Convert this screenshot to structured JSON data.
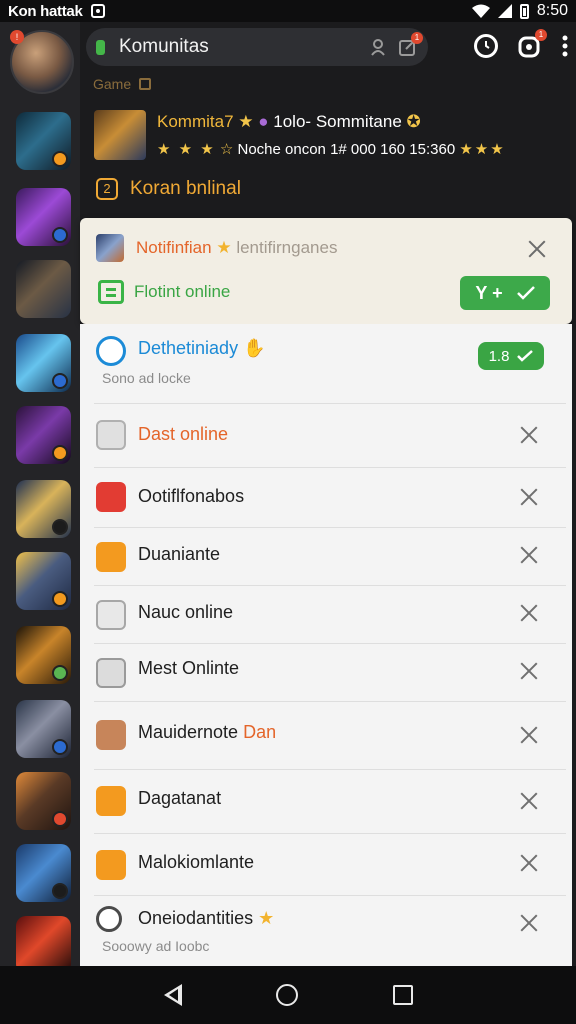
{
  "status_bar": {
    "title": "Kon hattak",
    "time": "8:50"
  },
  "top_bar": {
    "search_label": "Komunitas",
    "badge_count_1": "1",
    "badge_count_2": "1"
  },
  "section": {
    "label": "Game"
  },
  "featured": {
    "title": "Kommita7",
    "title_extra": "1olo-",
    "title_tail": "Sommitane",
    "stars": "★ ★ ★",
    "detail": "Noche oncon",
    "numbers": "1# 000 160 15:360",
    "stars2": "★★★"
  },
  "online_header": {
    "num": "2",
    "label": "Koran bnlinal"
  },
  "notification": {
    "title": "Notifinfian",
    "title_tail": "lentifirnganes",
    "subtitle": "Flotint online",
    "accept_label": "Y +"
  },
  "list": [
    {
      "label": "Dethetiniady",
      "sub": "Sono ad locke",
      "pill": "1.8",
      "color": "#1c8bd7",
      "label_color": "#1b8ad6"
    },
    {
      "label": "Dast online",
      "color": "#b0b0b0",
      "label_color": "#e4652a"
    },
    {
      "label": "Ootiflfonabos",
      "color": "#e23c33",
      "label_color": "#1f1f1f"
    },
    {
      "label": "Duaniante",
      "color": "#f39a1f",
      "label_color": "#1f1f1f"
    },
    {
      "label": "Nauc online",
      "color": "#a7a7a7",
      "label_color": "#1f1f1f"
    },
    {
      "label": "Mest Onlinte",
      "color": "#9a9a9a",
      "label_color": "#1f1f1f"
    },
    {
      "label": "Mauidernote",
      "label_tail": "Dan",
      "color": "#c7855a",
      "label_color": "#1f1f1f"
    },
    {
      "label": "Dagatanat",
      "color": "#f39a1f",
      "label_color": "#1f1f1f"
    },
    {
      "label": "Malokiomlante",
      "color": "#f39a1f",
      "label_color": "#1f1f1f"
    },
    {
      "label": "Oneiodantities",
      "sub": "Sooowy ad Ioobc",
      "color": "#4a4a4a",
      "label_color": "#1f1f1f"
    }
  ],
  "colors": {
    "accent_orange": "#f0a935",
    "accent_green": "#3da94a",
    "accent_red": "#e0492f"
  }
}
